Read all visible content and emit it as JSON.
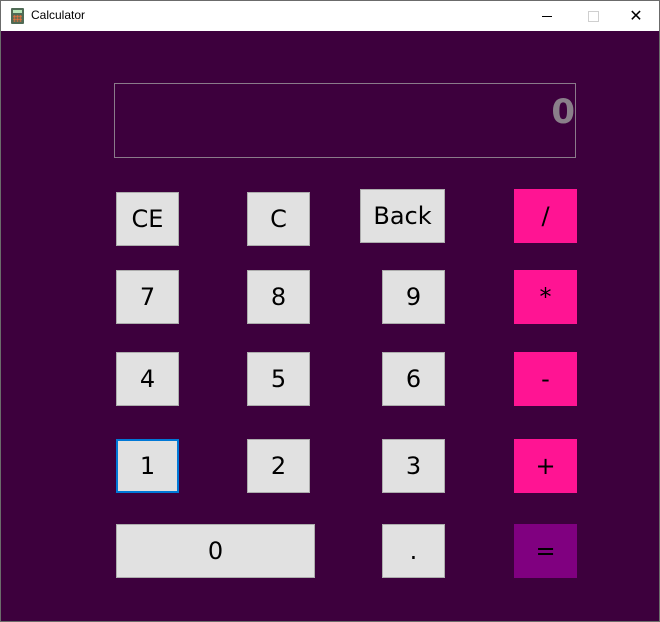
{
  "window": {
    "title": "Calculator",
    "close_glyph": "✕",
    "icons": {
      "app": "calculator-icon",
      "minimize": "minimize-icon",
      "maximize": "maximize-icon",
      "close": "close-icon"
    }
  },
  "display": {
    "value": "0"
  },
  "keys": {
    "ce": "CE",
    "c": "C",
    "back": "Back",
    "divide": "/",
    "seven": "7",
    "eight": "8",
    "nine": "9",
    "multiply": "*",
    "four": "4",
    "five": "5",
    "six": "6",
    "minus": "-",
    "one": "1",
    "two": "2",
    "three": "3",
    "plus": "+",
    "zero": "0",
    "dot": ".",
    "equals": "="
  },
  "colors": {
    "background": "#3d003d",
    "key": "#e1e1e1",
    "operator": "#ff1493",
    "equals": "#800080",
    "display_text": "#8a7f8a",
    "focus": "#0078d7"
  }
}
